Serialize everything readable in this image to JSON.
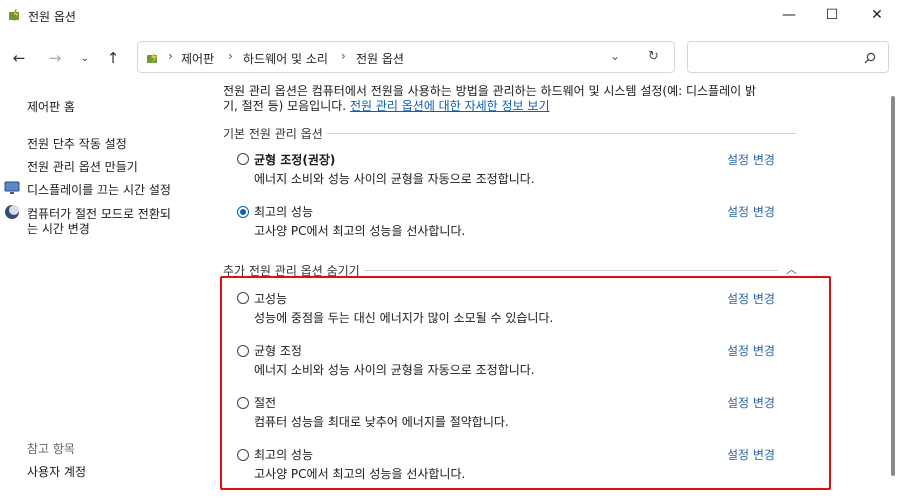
{
  "window": {
    "title": "전원 옵션",
    "minimize_glyph": "—",
    "maximize_glyph": "☐",
    "close_glyph": "✕"
  },
  "address": {
    "crumbs": [
      "제어판",
      "하드웨어 및 소리",
      "전원 옵션"
    ],
    "separator": "›",
    "search_placeholder": ""
  },
  "sidebar": {
    "home": "제어판 홈",
    "items": [
      "전원 단추 작동 설정",
      "전원 관리 옵션 만들기",
      "디스플레이를 끄는 시간 설정",
      "컴퓨터가 절전 모드로 전환되",
      "는 시간 변경"
    ],
    "see_also": "참고 항목",
    "user_accounts": "사용자 계정"
  },
  "main": {
    "intro_line1": "전원 관리 옵션은 컴퓨터에서 전원을 사용하는 방법을 관리하는 하드웨어 및 시스템 설정(예: 디스플레이 밝",
    "intro_line2": "기, 절전 등) 모음입니다.",
    "intro_link": "전원 관리 옵션에 대한 자세한 정보 보기",
    "basic_title": "기본 전원 관리 옵션",
    "extra_title": "추가 전원 관리 옵션 숨기기",
    "change_label": "설정 변경",
    "basic_plans": [
      {
        "name": "균형 조정(권장)",
        "desc": "에너지 소비와 성능 사이의 균형을 자동으로 조정합니다.",
        "selected": false
      },
      {
        "name": "최고의 성능",
        "desc": "고사양 PC에서 최고의 성능을 선사합니다.",
        "selected": true
      }
    ],
    "extra_plans": [
      {
        "name": "고성능",
        "desc": "성능에 중점을 두는 대신 에너지가 많이 소모될 수 있습니다.",
        "selected": false
      },
      {
        "name": "균형 조정",
        "desc": "에너지 소비와 성능 사이의 균형을 자동으로 조정합니다.",
        "selected": false
      },
      {
        "name": "절전",
        "desc": "컴퓨터 성능을 최대로 낮추어 에너지를 절약합니다.",
        "selected": false
      },
      {
        "name": "최고의 성능",
        "desc": "고사양 PC에서 최고의 성능을 선사합니다.",
        "selected": false
      }
    ]
  },
  "colors": {
    "link": "#0b5fb8",
    "highlight_box": "#e01010"
  }
}
